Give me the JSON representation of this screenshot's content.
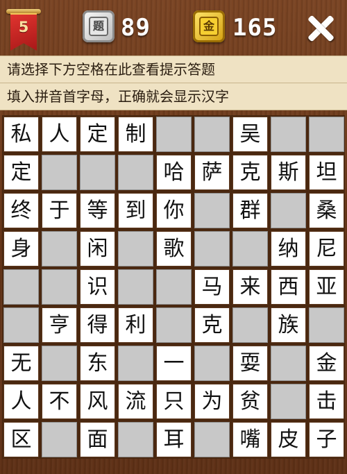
{
  "header": {
    "level": "5",
    "question_coin_label": "题",
    "question_count": "89",
    "gold_coin_label": "金",
    "gold_count": "165"
  },
  "hints": {
    "line1": "请选择下方空格在此查看提示答题",
    "line2": "填入拼音首字母，正确就会显示汉字"
  },
  "grid": [
    [
      "私",
      "人",
      "定",
      "制",
      "",
      "",
      "吴",
      "",
      ""
    ],
    [
      "定",
      "",
      "",
      "",
      "哈",
      "萨",
      "克",
      "斯",
      "坦"
    ],
    [
      "终",
      "于",
      "等",
      "到",
      "你",
      "",
      "群",
      "",
      "桑"
    ],
    [
      "身",
      "",
      "闲",
      "",
      "歌",
      "",
      "",
      "纳",
      "尼"
    ],
    [
      "",
      "",
      "识",
      "",
      "",
      "马",
      "来",
      "西",
      "亚"
    ],
    [
      "",
      "亨",
      "得",
      "利",
      "",
      "克",
      "",
      "族",
      ""
    ],
    [
      "无",
      "",
      "东",
      "",
      "一",
      "",
      "耍",
      "",
      "金"
    ],
    [
      "人",
      "不",
      "风",
      "流",
      "只",
      "为",
      "贫",
      "",
      "击"
    ],
    [
      "区",
      "",
      "面",
      "",
      "耳",
      "",
      "嘴",
      "皮",
      "子"
    ]
  ],
  "colors": {
    "wood": "#6a3819",
    "hint_bar": "#efe2c3",
    "filled_cell": "#ffffff",
    "empty_cell": "#c8c8c8"
  }
}
